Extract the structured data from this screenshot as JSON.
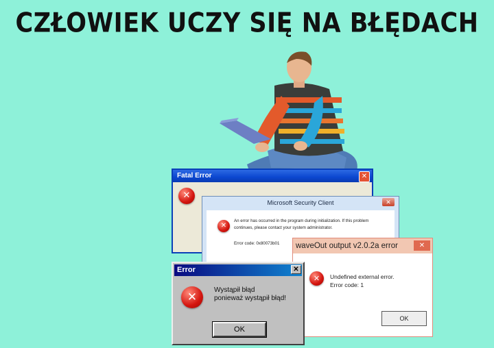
{
  "headline": "CZŁOWIEK UCZY SIĘ NA BŁĘDACH",
  "icons": {
    "error": "error-x-icon",
    "close": "close-x-icon"
  },
  "windows": {
    "fatal": {
      "title": "Fatal Error",
      "close": "✕"
    },
    "msc": {
      "title": "Microsoft Security Client",
      "close": "✕",
      "message": "An error has occurred in the program during initialization. If this problem continues, please contact your system administrator.",
      "code": "Error code: 0x80073b01"
    },
    "win98": {
      "title": "Error",
      "close": "✕",
      "line1": "Wystąpił błąd",
      "line2": "ponieważ wystąpił błąd!",
      "ok": "OK"
    },
    "waveout": {
      "title": "waveOut output v2.0.2a error",
      "close": "✕",
      "line1": "Undefined external error.",
      "line2": "Error code: 1",
      "ok": "OK"
    }
  }
}
